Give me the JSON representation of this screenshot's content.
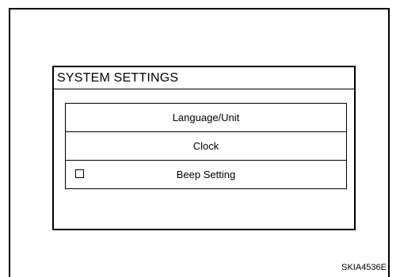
{
  "screen": {
    "title": "SYSTEM SETTINGS"
  },
  "menu": {
    "items": [
      {
        "label": "Language/Unit"
      },
      {
        "label": "Clock"
      },
      {
        "label": "Beep Setting",
        "checkbox": {
          "checked": false
        }
      }
    ]
  },
  "figure_code": "SKIA4536E"
}
